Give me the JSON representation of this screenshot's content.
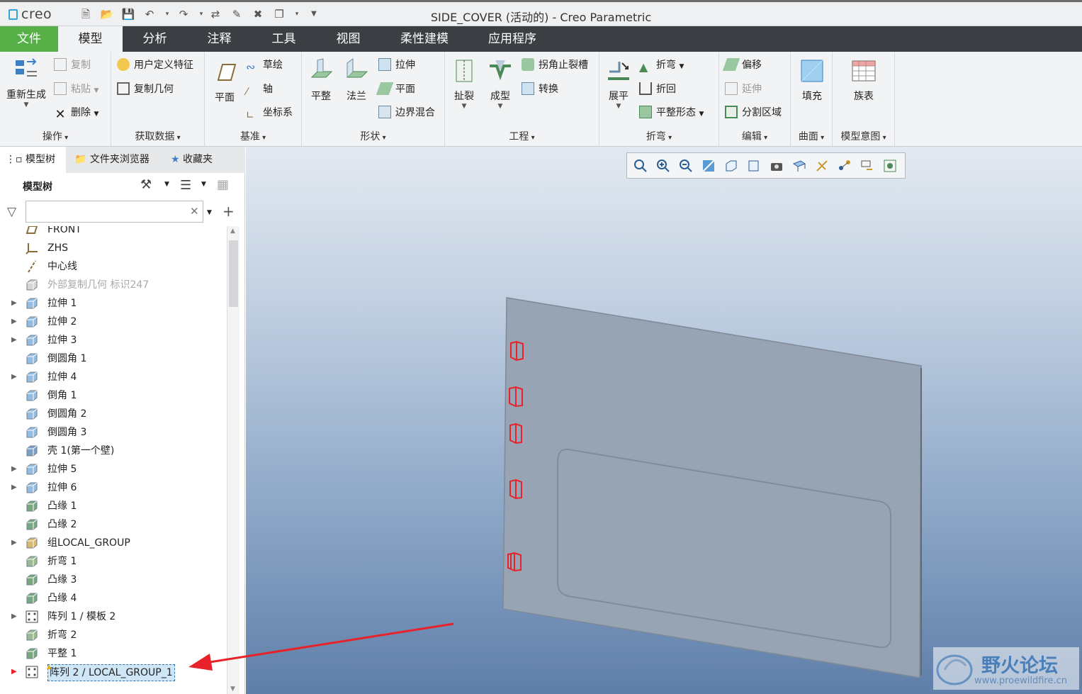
{
  "app": {
    "logo": "creo",
    "title": "SIDE_COVER (活动的) - Creo Parametric"
  },
  "tabs": [
    {
      "label": "文件"
    },
    {
      "label": "模型"
    },
    {
      "label": "分析"
    },
    {
      "label": "注释"
    },
    {
      "label": "工具"
    },
    {
      "label": "视图"
    },
    {
      "label": "柔性建模"
    },
    {
      "label": "应用程序"
    }
  ],
  "ribbon": {
    "ops": {
      "label": "操作",
      "regen": "重新生成",
      "copy": "复制",
      "paste": "粘贴",
      "delete": "删除"
    },
    "getdata": {
      "label": "获取数据",
      "udf": "用户定义特征",
      "copygeom": "复制几何"
    },
    "datum": {
      "label": "基准",
      "plane": "平面",
      "sketch": "草绘",
      "axis": "轴",
      "csys": "坐标系"
    },
    "shapes": {
      "label": "形状",
      "flat": "平整",
      "flange": "法兰",
      "extrude": "拉伸",
      "planar": "平面",
      "blend": "边界混合"
    },
    "eng": {
      "label": "工程",
      "rip": "扯裂",
      "form": "成型",
      "corner": "拐角止裂槽",
      "convert": "转换"
    },
    "bend": {
      "label": "折弯",
      "unbend": "展平",
      "bend": "折弯",
      "bendback": "折回",
      "flatform": "平整形态"
    },
    "edit": {
      "label": "编辑",
      "offset": "偏移",
      "extend": "延伸",
      "split": "分割区域"
    },
    "surface": {
      "label": "曲面",
      "fill": "填充"
    },
    "intent": {
      "label": "模型意图",
      "family": "族表"
    }
  },
  "navtabs": [
    {
      "label": "模型树"
    },
    {
      "label": "文件夹浏览器"
    },
    {
      "label": "收藏夹"
    }
  ],
  "tree": {
    "header": "模型树",
    "filter_value": "",
    "items": [
      {
        "label": "FRONT",
        "icon": "datum-plane-icon",
        "exp": false
      },
      {
        "label": "ZHS",
        "icon": "csys-icon",
        "exp": false
      },
      {
        "label": "中心线",
        "icon": "axis-icon",
        "exp": false
      },
      {
        "label": "外部复制几何 标识247",
        "icon": "copy-geom-icon",
        "exp": false,
        "dim": true
      },
      {
        "label": "拉伸 1",
        "icon": "extrude-icon",
        "exp": true
      },
      {
        "label": "拉伸 2",
        "icon": "extrude-icon",
        "exp": true
      },
      {
        "label": "拉伸 3",
        "icon": "extrude-icon",
        "exp": true
      },
      {
        "label": "倒圆角 1",
        "icon": "round-icon",
        "exp": false
      },
      {
        "label": "拉伸 4",
        "icon": "extrude-icon",
        "exp": true
      },
      {
        "label": "倒角 1",
        "icon": "chamfer-icon",
        "exp": false
      },
      {
        "label": "倒圆角 2",
        "icon": "round-icon",
        "exp": false
      },
      {
        "label": "倒圆角 3",
        "icon": "round-icon",
        "exp": false
      },
      {
        "label": "壳 1(第一个壁)",
        "icon": "shell-icon",
        "exp": false
      },
      {
        "label": "拉伸 5",
        "icon": "extrude-icon",
        "exp": true
      },
      {
        "label": "拉伸 6",
        "icon": "extrude-icon",
        "exp": true
      },
      {
        "label": "凸缘 1",
        "icon": "flange-icon",
        "exp": false
      },
      {
        "label": "凸缘 2",
        "icon": "flange-icon",
        "exp": false
      },
      {
        "label": "组LOCAL_GROUP",
        "icon": "group-icon",
        "exp": true
      },
      {
        "label": "折弯 1",
        "icon": "bend-icon",
        "exp": false
      },
      {
        "label": "凸缘 3",
        "icon": "flange-icon",
        "exp": false
      },
      {
        "label": "凸缘 4",
        "icon": "flange-icon",
        "exp": false
      },
      {
        "label": "阵列 1 / 模板 2",
        "icon": "pattern-icon",
        "exp": true
      },
      {
        "label": "折弯 2",
        "icon": "bend-icon",
        "exp": false
      },
      {
        "label": "平整 1",
        "icon": "flat-icon",
        "exp": false
      },
      {
        "label": "阵列 2 / LOCAL_GROUP_1",
        "icon": "pattern-icon",
        "exp": true,
        "selected": true
      }
    ]
  },
  "watermark": {
    "title": "野火论坛",
    "url": "www.proewildfire.cn"
  },
  "colors": {
    "accent_green": "#57b047",
    "tabbar": "#3b3f44",
    "highlight_red": "#e8222a",
    "part_gray": "#98a4b3"
  }
}
